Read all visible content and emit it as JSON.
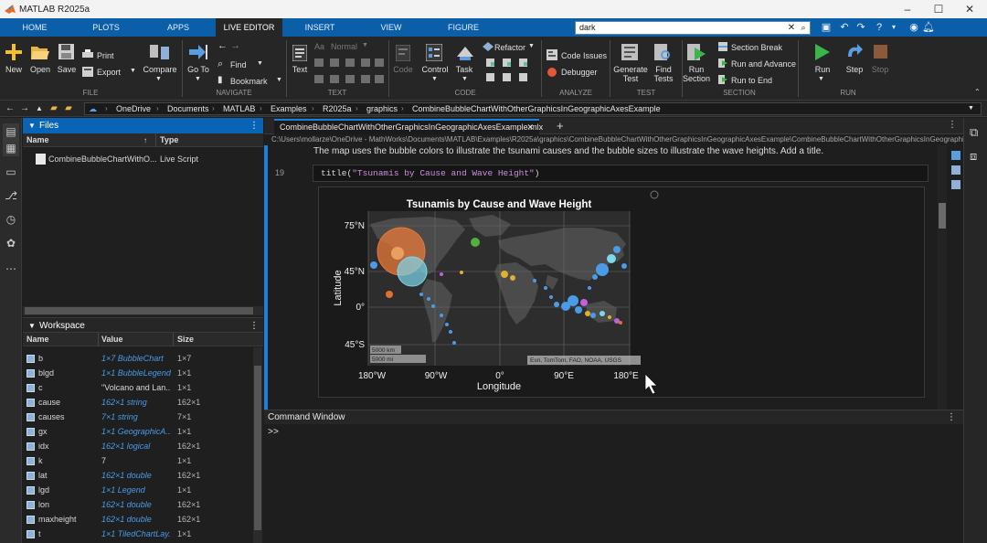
{
  "window": {
    "title": "MATLAB R2025a"
  },
  "tabs": [
    {
      "label": "HOME",
      "active": false
    },
    {
      "label": "PLOTS",
      "active": false
    },
    {
      "label": "APPS",
      "active": false
    },
    {
      "label": "LIVE EDITOR",
      "active": true
    },
    {
      "label": "INSERT",
      "active": false
    },
    {
      "label": "VIEW",
      "active": false
    },
    {
      "label": "FIGURE",
      "active": false
    }
  ],
  "search": {
    "value": "dark"
  },
  "ribbon": {
    "file": {
      "new": "New",
      "open": "Open",
      "save": "Save",
      "print": "Print",
      "export": "Export",
      "compare": "Compare",
      "group": "FILE"
    },
    "navigate": {
      "goto": "Go To",
      "find": "Find",
      "bookmark": "Bookmark",
      "group": "NAVIGATE"
    },
    "text": {
      "text": "Text",
      "style": "Normal",
      "group": "TEXT"
    },
    "code": {
      "code": "Code",
      "control": "Control",
      "task": "Task",
      "refactor": "Refactor",
      "group": "CODE"
    },
    "analyze": {
      "code_issues": "Code Issues",
      "debugger": "Debugger",
      "group": "ANALYZE"
    },
    "test": {
      "generate": "Generate",
      "generate2": "Test",
      "find": "Find",
      "find2": "Tests",
      "group": "TEST"
    },
    "section": {
      "run": "Run",
      "run2": "Section",
      "section_break": "Section Break",
      "run_advance": "Run and Advance",
      "run_end": "Run to End",
      "group": "SECTION"
    },
    "run": {
      "run": "Run",
      "step": "Step",
      "stop": "Stop",
      "group": "RUN"
    }
  },
  "breadcrumbs": [
    "OneDrive",
    "Documents",
    "MATLAB",
    "Examples",
    "R2025a",
    "graphics",
    "CombineBubbleChartWithOtherGraphicsInGeographicAxesExample"
  ],
  "files": {
    "title": "Files",
    "col_name": "Name",
    "col_type": "Type",
    "items": [
      {
        "name": "CombineBubbleChartWithO...",
        "type": "Live Script"
      }
    ]
  },
  "workspace": {
    "title": "Workspace",
    "col_name": "Name",
    "col_value": "Value",
    "col_size": "Size",
    "rows": [
      {
        "name": "b",
        "value": "1×7 BubbleChart",
        "size": "1×7",
        "link": true
      },
      {
        "name": "blgd",
        "value": "1×1 BubbleLegend",
        "size": "1×1",
        "link": true
      },
      {
        "name": "c",
        "value": "\"Volcano and Lan...",
        "size": "1×1",
        "link": false
      },
      {
        "name": "cause",
        "value": "162×1 string",
        "size": "162×1",
        "link": true
      },
      {
        "name": "causes",
        "value": "7×1 string",
        "size": "7×1",
        "link": true
      },
      {
        "name": "gx",
        "value": "1×1 GeographicA...",
        "size": "1×1",
        "link": true
      },
      {
        "name": "idx",
        "value": "162×1 logical",
        "size": "162×1",
        "link": true
      },
      {
        "name": "k",
        "value": "7",
        "size": "1×1",
        "link": false
      },
      {
        "name": "lat",
        "value": "162×1 double",
        "size": "162×1",
        "link": true
      },
      {
        "name": "lgd",
        "value": "1×1 Legend",
        "size": "1×1",
        "link": true
      },
      {
        "name": "lon",
        "value": "162×1 double",
        "size": "162×1",
        "link": true
      },
      {
        "name": "maxheight",
        "value": "162×1 double",
        "size": "162×1",
        "link": true
      },
      {
        "name": "t",
        "value": "1×1 TiledChartLay...",
        "size": "1×1",
        "link": true
      }
    ]
  },
  "editor": {
    "tab_name": "CombineBubbleChartWithOtherGraphicsInGeographicAxesExample.mlx",
    "path": "C:\\Users\\mollarze\\OneDrive - MathWorks\\Documents\\MATLAB\\Examples\\R2025a\\graphics\\CombineBubbleChartWithOtherGraphicsInGeographicAxesExample\\CombineBubbleChartWithOtherGraphicsInGeographicAxesExamp...",
    "paragraph": "The map uses the bubble colors to illustrate the tsunami causes and the bubble sizes to illustrate the wave heights. Add a title.",
    "line_number": "19",
    "code_func": "title(",
    "code_str": "\"Tsunamis by Cause and Wave Height\"",
    "code_end": ")"
  },
  "figure": {
    "title": "Tsunamis by Cause and Wave Height",
    "ylabel": "Latitude",
    "xlabel": "Longitude",
    "lat_ticks": [
      "75°N",
      "45°N",
      "0°",
      "45°S"
    ],
    "lon_ticks": [
      "180°W",
      "90°W",
      "0°",
      "90°E",
      "180°E"
    ],
    "scale_km": "5000 km",
    "scale_mi": "5000 mi",
    "attribution": "Esri, TomTom, FAO, NOAA, USGS",
    "colors": {
      "background": "#1a1a1a",
      "ocean": "#2b2b2b",
      "land": "#4a4a4a"
    }
  },
  "command_window": {
    "title": "Command Window",
    "prompt": ">>"
  }
}
